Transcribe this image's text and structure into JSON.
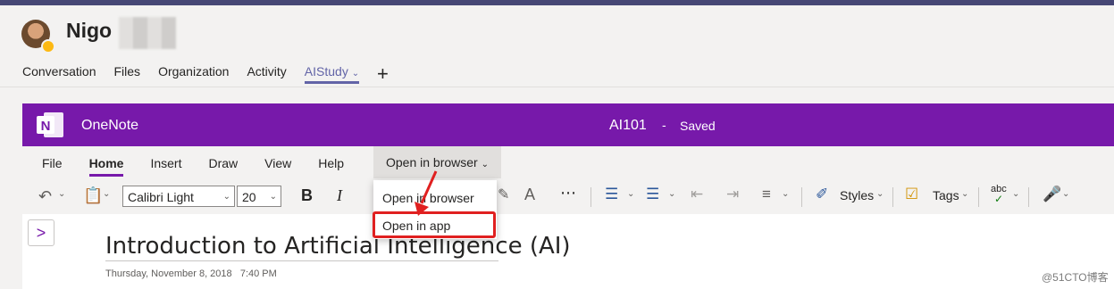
{
  "header": {
    "user_name": "Nigo",
    "tabs": [
      "Conversation",
      "Files",
      "Organization",
      "Activity",
      "AIStudy"
    ],
    "active_tab": "AIStudy",
    "add_tab_symbol": "+"
  },
  "onenote": {
    "app_name": "OneNote",
    "document_title": "AI101",
    "separator": "-",
    "status": "Saved",
    "brand_color": "#7719aa"
  },
  "ribbon": {
    "menu": [
      "File",
      "Home",
      "Insert",
      "Draw",
      "View",
      "Help"
    ],
    "active_menu": "Home",
    "open_dropdown_label": "Open in browser",
    "font_name": "Calibri Light",
    "font_size": "20",
    "bold": "B",
    "italic": "I",
    "styles_label": "Styles",
    "tags_label": "Tags",
    "spell_icon_text": "abc"
  },
  "dropdown": {
    "items": [
      "Open in browser",
      "Open in app"
    ]
  },
  "page": {
    "title": "Introduction to Artificial Intelligence (AI)",
    "date": "Thursday, November 8, 2018",
    "time": "7:40 PM",
    "expand_symbol": ">"
  },
  "watermark": "@51CTO博客"
}
